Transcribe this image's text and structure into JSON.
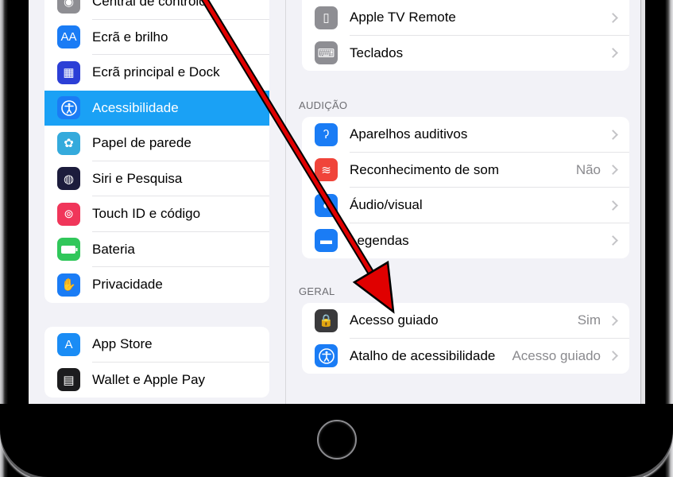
{
  "sidebar": {
    "group1": [
      {
        "label": "Central de controlo",
        "icon": "control-center-icon",
        "color": "#8e8e93"
      },
      {
        "label": "Ecrã e brilho",
        "icon": "text-size-icon",
        "color": "#1a7cf5"
      },
      {
        "label": "Ecrã principal e Dock",
        "icon": "home-grid-icon",
        "color": "#2c3fd6"
      },
      {
        "label": "Acessibilidade",
        "icon": "accessibility-icon",
        "color": "#1a7cf5",
        "selected": true
      },
      {
        "label": "Papel de parede",
        "icon": "wallpaper-flower-icon",
        "color": "#34aadc"
      },
      {
        "label": "Siri e Pesquisa",
        "icon": "siri-icon",
        "color": "#1c1c3c"
      },
      {
        "label": "Touch ID e código",
        "icon": "fingerprint-icon",
        "color": "#f0365a"
      },
      {
        "label": "Bateria",
        "icon": "battery-icon",
        "color": "#30c75a"
      },
      {
        "label": "Privacidade",
        "icon": "hand-icon",
        "color": "#1a7cf5"
      }
    ],
    "group2": [
      {
        "label": "App Store",
        "icon": "app-store-icon",
        "color": "#1a8cf5"
      },
      {
        "label": "Wallet e Apple Pay",
        "icon": "wallet-icon",
        "color": "#1c1c1e"
      }
    ]
  },
  "detail": {
    "top_group": [
      {
        "label": "Apple TV Remote",
        "icon": "tv-remote-icon",
        "color": "#8e8e93"
      },
      {
        "label": "Teclados",
        "icon": "keyboard-icon",
        "color": "#8e8e93"
      }
    ],
    "audicao": {
      "header": "AUDIÇÃO",
      "items": [
        {
          "label": "Aparelhos auditivos",
          "icon": "ear-icon",
          "color": "#1a7cf5",
          "value": ""
        },
        {
          "label": "Reconhecimento de som",
          "icon": "sound-recognition-icon",
          "color": "#f0443a",
          "value": "Não"
        },
        {
          "label": "Áudio/visual",
          "icon": "audio-visual-icon",
          "color": "#1a7cf5",
          "value": ""
        },
        {
          "label": "Legendas",
          "icon": "subtitles-icon",
          "color": "#1a7cf5",
          "value": ""
        }
      ]
    },
    "geral": {
      "header": "GERAL",
      "items": [
        {
          "label": "Acesso guiado",
          "icon": "guided-access-lock-icon",
          "color": "#3a3a3c",
          "value": "Sim"
        },
        {
          "label": "Atalho de acessibilidade",
          "icon": "accessibility-icon",
          "color": "#1a7cf5",
          "value": "Acesso guiado"
        }
      ]
    }
  },
  "annotation": {
    "type": "red-arrow",
    "color": "#e00000",
    "points_to": "Acesso guiado"
  }
}
